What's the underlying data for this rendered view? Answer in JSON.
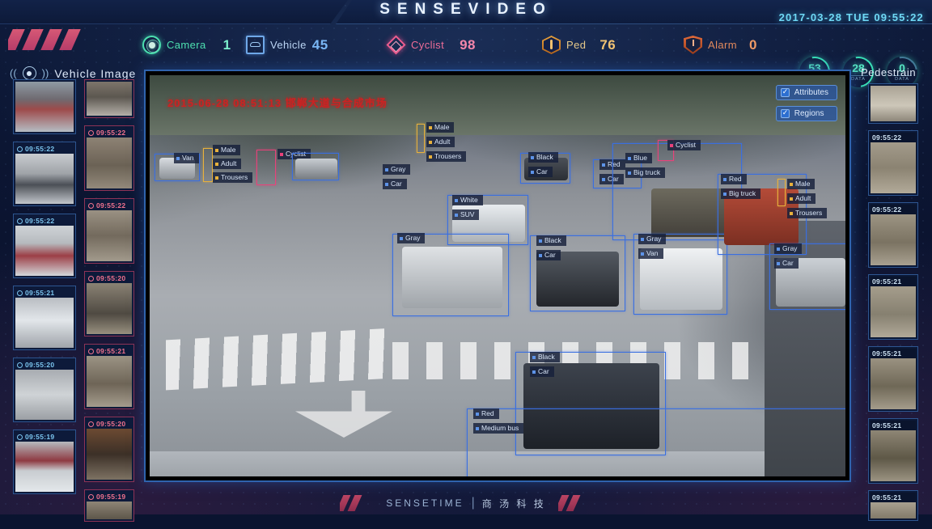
{
  "header": {
    "title": "SENSEVIDEO",
    "timestamp": "2017-03-28 TUE 09:55:22"
  },
  "stats": [
    {
      "icon": "camera-icon",
      "label": "Camera",
      "value": "1",
      "color": "#4de0b0"
    },
    {
      "icon": "vehicle-icon",
      "label": "Vehicle",
      "value": "45",
      "color": "#6fa8e8"
    },
    {
      "icon": "cyclist-icon",
      "label": "Cyclist",
      "value": "98",
      "color": "#ef5d8f"
    },
    {
      "icon": "ped-icon",
      "label": "Ped",
      "value": "76",
      "color": "#e8b13c"
    },
    {
      "icon": "alarm-icon",
      "label": "Alarm",
      "value": "0",
      "color": "#e07a46"
    }
  ],
  "gauges": [
    {
      "value": "53",
      "sub": "DATA"
    },
    {
      "value": "28",
      "sub": "DATA"
    },
    {
      "value": "0",
      "sub": "DATA"
    }
  ],
  "left_panel": {
    "title": "Vehicle  Image",
    "vehicle_thumbs": [
      {
        "time": ""
      },
      {
        "time": "09:55:22"
      },
      {
        "time": "09:55:22"
      },
      {
        "time": "09:55:21"
      },
      {
        "time": "09:55:20"
      },
      {
        "time": "09:55:19"
      }
    ],
    "cyclist_thumbs": [
      {
        "time": ""
      },
      {
        "time": "09:55:22"
      },
      {
        "time": "09:55:22"
      },
      {
        "time": "09:55:20"
      },
      {
        "time": "09:55:21"
      },
      {
        "time": "09:55:20"
      },
      {
        "time": "09:55:19"
      }
    ]
  },
  "right_panel": {
    "title": "Pedestrain",
    "thumbs": [
      {
        "time": ""
      },
      {
        "time": "09:55:22"
      },
      {
        "time": "09:55:22"
      },
      {
        "time": "09:55:21"
      },
      {
        "time": "09:55:21"
      },
      {
        "time": "09:55:21"
      },
      {
        "time": "09:55:21"
      }
    ]
  },
  "video": {
    "overlay_stamp": "2015-06-28 08:51:13  邯郸大道与合成市场",
    "buttons": [
      {
        "label": "Attributes",
        "checked": true
      },
      {
        "label": "Regions",
        "checked": true
      }
    ],
    "detections": [
      {
        "type": "vehicle",
        "labels": [
          "Van"
        ]
      },
      {
        "type": "person",
        "labels": [
          "Male",
          "Adult",
          "Trousers"
        ]
      },
      {
        "type": "cyclist",
        "labels": [
          "Cyclist"
        ]
      },
      {
        "type": "vehicle",
        "labels": [
          "Gray",
          "Car"
        ]
      },
      {
        "type": "person",
        "labels": [
          "Male",
          "Adult",
          "Trousers"
        ]
      },
      {
        "type": "vehicle",
        "labels": [
          "Black",
          "Car"
        ]
      },
      {
        "type": "vehicle",
        "labels": [
          "Red",
          "Car"
        ]
      },
      {
        "type": "vehicle",
        "labels": [
          "Blue",
          "Big truck"
        ]
      },
      {
        "type": "cyclist",
        "labels": [
          "Cyclist"
        ]
      },
      {
        "type": "vehicle",
        "labels": [
          "White",
          "SUV"
        ]
      },
      {
        "type": "vehicle",
        "labels": [
          "Gray"
        ]
      },
      {
        "type": "vehicle",
        "labels": [
          "Black",
          "Car"
        ]
      },
      {
        "type": "vehicle",
        "labels": [
          "Gray",
          "Van"
        ]
      },
      {
        "type": "vehicle",
        "labels": [
          "Red",
          "Big truck"
        ]
      },
      {
        "type": "person",
        "labels": [
          "Male",
          "Adult",
          "Trousers"
        ]
      },
      {
        "type": "vehicle",
        "labels": [
          "Gray",
          "Car"
        ]
      },
      {
        "type": "vehicle",
        "labels": [
          "Black",
          "Car"
        ]
      },
      {
        "type": "vehicle",
        "labels": [
          "Red",
          "Medium bus"
        ]
      }
    ]
  },
  "footer": {
    "brand": "SENSETIME",
    "divider": "|",
    "brand_cn": "商 汤 科 技"
  }
}
